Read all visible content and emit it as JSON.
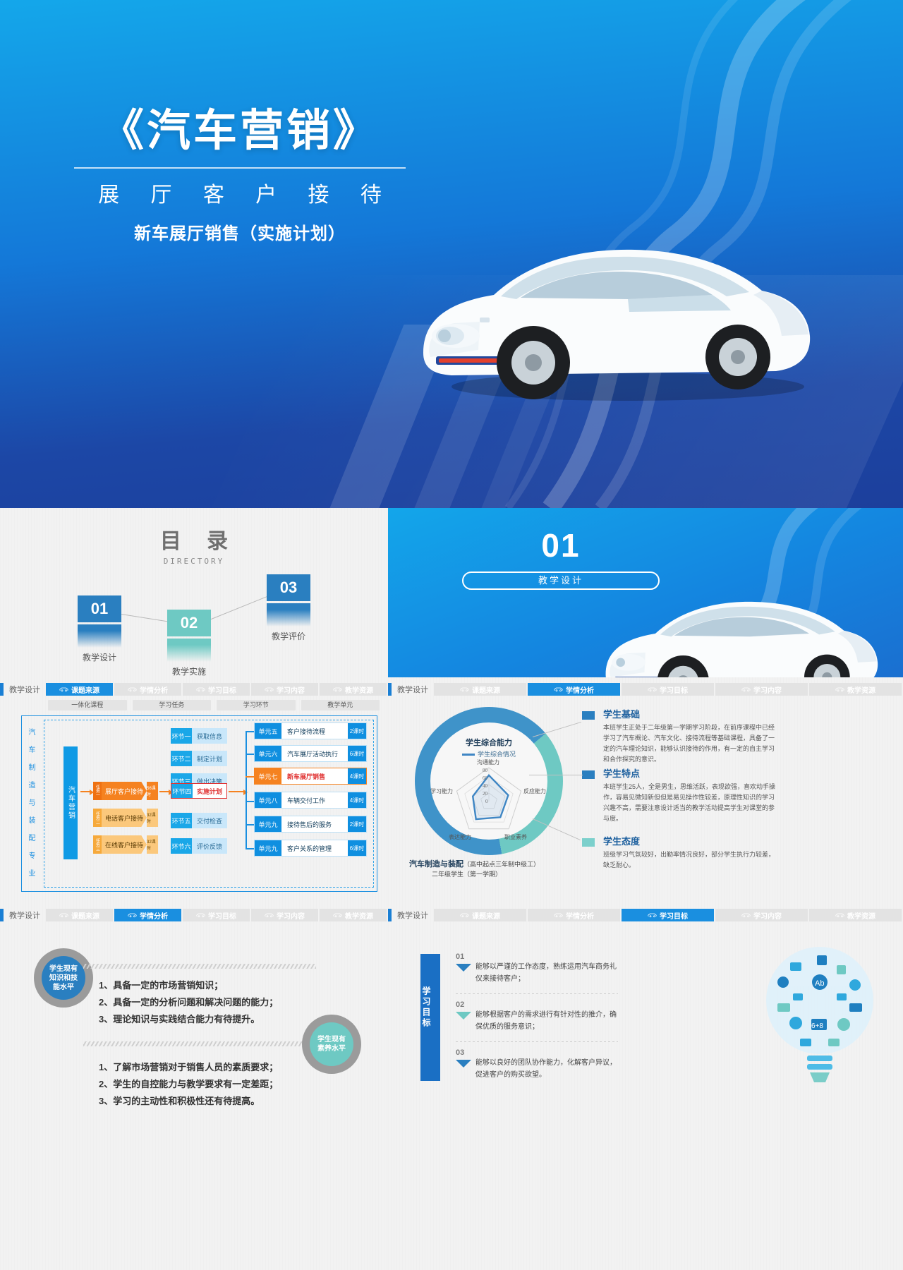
{
  "title_slide": {
    "main_title": "《汽车营销》",
    "sub_title": "展 厅 客 户 接 待",
    "sub_title2": "新车展厅销售（实施计划）",
    "car_alt": "white-sedan"
  },
  "directory": {
    "heading_cn": "目 录",
    "heading_en": "DIRECTORY",
    "items": [
      {
        "num": "01",
        "label": "教学设计",
        "color": "#2a7fc0"
      },
      {
        "num": "02",
        "label": "教学实施",
        "color": "#6ec9c3"
      },
      {
        "num": "03",
        "label": "教学评价",
        "color": "#2a7fc0"
      }
    ]
  },
  "section_slide": {
    "number": "01",
    "label": "教学设计"
  },
  "nav": {
    "home": "教学设计",
    "tabs": [
      "课题来源",
      "学情分析",
      "学习目标",
      "学习内容",
      "教学资源"
    ]
  },
  "panel_source": {
    "active_tab": "课题来源",
    "chips": [
      "一体化课程",
      "学习任务",
      "学习环节",
      "教学单元"
    ],
    "major": "汽 车 制 造 与 装 配 专 业",
    "course": "汽车营销",
    "tasks": [
      {
        "no": "任务一",
        "name": "展厅客户接待",
        "hours": "56课时",
        "highlight": true
      },
      {
        "no": "任务二",
        "name": "电话客户接待",
        "hours": "32课时",
        "highlight": false
      },
      {
        "no": "任务三",
        "name": "在线客户接待",
        "hours": "32课时",
        "highlight": false
      }
    ],
    "links": [
      {
        "no": "环节一",
        "name": "获取信息",
        "highlight": false
      },
      {
        "no": "环节二",
        "name": "制定计划",
        "highlight": false
      },
      {
        "no": "环节三",
        "name": "做出决策",
        "highlight": false
      },
      {
        "no": "环节四",
        "name": "实施计划",
        "highlight": true
      },
      {
        "no": "环节五",
        "name": "交付检查",
        "highlight": false
      },
      {
        "no": "环节六",
        "name": "评价反馈",
        "highlight": false
      }
    ],
    "units": [
      {
        "no": "单元五",
        "name": "客户接待流程",
        "hours": "2课时",
        "highlight": false
      },
      {
        "no": "单元六",
        "name": "汽车展厅活动执行",
        "hours": "6课时",
        "highlight": false
      },
      {
        "no": "单元七",
        "name": "新车展厅销售",
        "hours": "4课时",
        "highlight": true
      },
      {
        "no": "单元八",
        "name": "车辆交付工作",
        "hours": "4课时",
        "highlight": false
      },
      {
        "no": "单元九",
        "name": "接待售后的服务",
        "hours": "2课时",
        "highlight": false
      },
      {
        "no": "单元九",
        "name": "客户关系的管理",
        "hours": "6课时",
        "highlight": false
      }
    ]
  },
  "panel_analysis": {
    "active_tab": "学情分析",
    "caption_main": "汽车制造与装配",
    "caption_level": "（高中起点三年制中级工）",
    "caption_sub": "二年级学生（第一学期）",
    "blocks": [
      {
        "heading": "学生基础",
        "text": "本班学生正处于二年级第一学期学习阶段，在前序课程中已经学习了汽车概论、汽车文化、接待流程等基础课程，具备了一定的汽车理论知识，能够认识接待的作用，有一定的自主学习和合作探究的意识。"
      },
      {
        "heading": "学生特点",
        "text": "本班学生25人，全是男生，思维活跃，表现欲强，喜欢动手操作，容易见微知新但但是易见操作性较差，原理性知识的学习兴趣不高，需要注意设计适当的教学活动提高学生对课堂的参与度。"
      },
      {
        "heading": "学生态度",
        "text": "班级学习气氛较好，出勤率情况良好，部分学生执行力较差，缺乏耐心。"
      }
    ],
    "chart_data": {
      "type": "radar",
      "title": "学生综合能力",
      "legend": [
        "学生综合情况"
      ],
      "categories": [
        "沟通能力",
        "反应能力",
        "职业素养",
        "表达能力",
        "学习能力"
      ],
      "values": [
        62,
        48,
        46,
        52,
        40
      ],
      "ticks": [
        0,
        20,
        40,
        60,
        80
      ],
      "rmax": 80,
      "series_color": "#3f86c4"
    }
  },
  "panel_level": {
    "active_tab": "学情分析",
    "ring_left": "学生现有\n知识和技\n能水平",
    "ring_right": "学生现有\n素养水平",
    "list_top": [
      "1、具备一定的市场营销知识；",
      "2、具备一定的分析问题和解决问题的能力；",
      "3、理论知识与实践结合能力有待提升。"
    ],
    "list_bottom": [
      "1、了解市场营销对于销售人员的素质要求；",
      "2、学生的自控能力与教学要求有一定差距；",
      "3、学习的主动性和积极性还有待提高。"
    ]
  },
  "panel_goals": {
    "active_tab": "学习目标",
    "bar_label": "学习目标",
    "goals": [
      {
        "no": "01",
        "text": "能够以严谨的工作态度，熟练运用汽车商务礼仪来接待客户；"
      },
      {
        "no": "02",
        "text": "能够根据客户的需求进行有针对性的推介，确保优质的服务意识；"
      },
      {
        "no": "03",
        "text": "能够以良好的团队协作能力，化解客户异议，促进客户的购买欲望。"
      }
    ]
  },
  "colors": {
    "brand_blue": "#1a8fe0",
    "deep_blue": "#1c47a6",
    "teal": "#6ec9c3",
    "orange": "#f58220",
    "red": "#e03131"
  }
}
